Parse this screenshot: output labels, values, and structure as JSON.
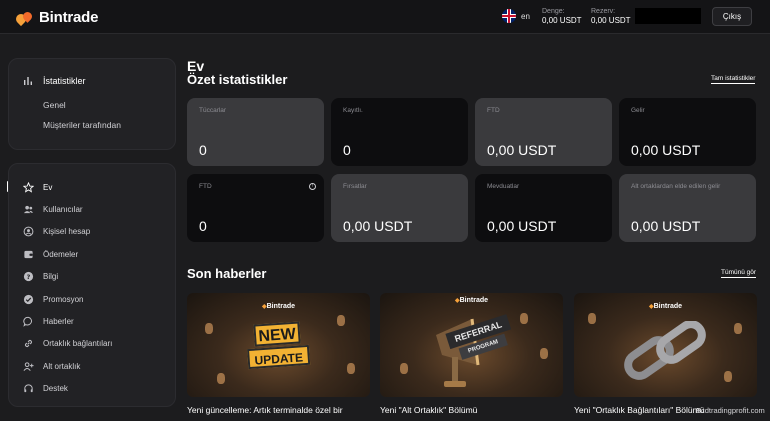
{
  "header": {
    "brand": "Bintrade",
    "lang": "en",
    "balance": {
      "label": "Denge:",
      "value": "0,00 USDT"
    },
    "reserve": {
      "label": "Rezerv:",
      "value": "0,00 USDT"
    },
    "logout": "Çıkış"
  },
  "sidebar": {
    "stats": {
      "title": "İstatistikler",
      "items": [
        "Genel",
        "Müşteriler tarafından"
      ]
    },
    "nav": [
      {
        "label": "Ev",
        "icon": "star-icon",
        "active": true
      },
      {
        "label": "Kullanıcılar",
        "icon": "users-icon"
      },
      {
        "label": "Kişisel hesap",
        "icon": "account-icon"
      },
      {
        "label": "Ödemeler",
        "icon": "wallet-icon"
      },
      {
        "label": "Bilgi",
        "icon": "info-icon"
      },
      {
        "label": "Promosyon",
        "icon": "promo-icon"
      },
      {
        "label": "Haberler",
        "icon": "chat-icon"
      },
      {
        "label": "Ortaklık bağlantıları",
        "icon": "link-icon"
      },
      {
        "label": "Alt ortaklık",
        "icon": "add-user-icon"
      },
      {
        "label": "Destek",
        "icon": "headset-icon"
      }
    ]
  },
  "main": {
    "page_title": "Ev",
    "summary_title": "Özet istatistikler",
    "full_stats_link": "Tam istatistikler",
    "cards": [
      {
        "label": "Tüccarlar",
        "value": "0",
        "style": "gray"
      },
      {
        "label": "Kayıtlı.",
        "value": "0",
        "style": "dark"
      },
      {
        "label": "FTD",
        "value": "0,00 USDT",
        "style": "gray"
      },
      {
        "label": "Gelir",
        "value": "0,00 USDT",
        "style": "dark"
      },
      {
        "label": "FTD",
        "value": "0",
        "style": "dark",
        "info": true
      },
      {
        "label": "Fırsatlar",
        "value": "0,00 USDT",
        "style": "gray"
      },
      {
        "label": "Mevduatlar",
        "value": "0,00 USDT",
        "style": "dark"
      },
      {
        "label": "Alt ortaklardan elde edilen gelir",
        "value": "0,00 USDT",
        "style": "gray"
      }
    ],
    "news_title": "Son haberler",
    "see_all": "Tümünü gör",
    "news": [
      {
        "brand": "Bintrade",
        "art_top": "NEW",
        "art_bottom": "UPDATE",
        "title": "Yeni güncelleme: Artık terminalde özel bir"
      },
      {
        "brand": "Bintrade",
        "art_top": "REFERRAL",
        "art_bottom": "PROGRAM",
        "title": "Yeni \"Alt Ortaklık\" Bölümü"
      },
      {
        "brand": "Bintrade",
        "title": "Yeni \"Ortaklık Bağlantıları\" Bölümü"
      }
    ]
  },
  "watermark": "Bcdtradingprofit.com"
}
